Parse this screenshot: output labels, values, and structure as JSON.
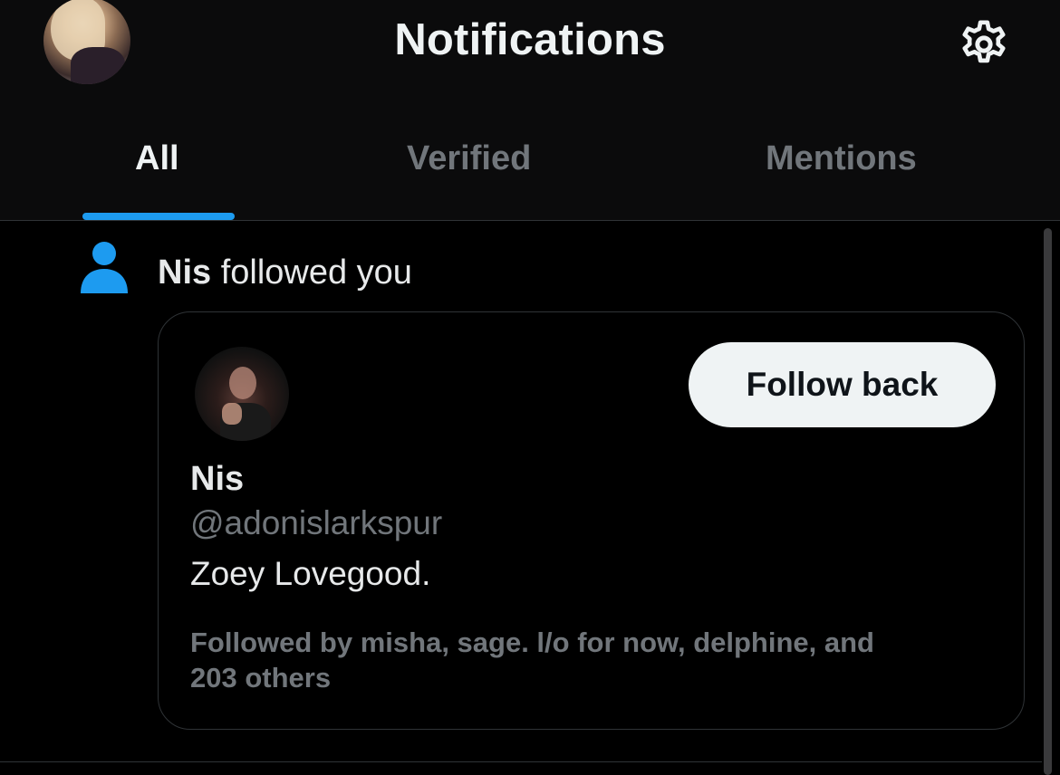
{
  "header": {
    "title": "Notifications",
    "profile_avatar": "profile-avatar-photo",
    "settings_icon": "gear-icon"
  },
  "tabs": [
    {
      "label": "All",
      "active": true
    },
    {
      "label": "Verified",
      "active": false
    },
    {
      "label": "Mentions",
      "active": false
    }
  ],
  "colors": {
    "accent": "#1d9bf0",
    "background": "#000000",
    "secondary_text": "#71767b"
  },
  "notification": {
    "icon": "person-icon",
    "actor": "Nis",
    "action": " followed you",
    "card": {
      "name": "Nis",
      "handle": "@adonislarkspur",
      "bio": "Zoey Lovegood.",
      "follow_button_label": "Follow back",
      "followed_by_line1": "Followed by misha, sage. l/o for now, delphine, and",
      "followed_by_line2": "203 others"
    }
  }
}
